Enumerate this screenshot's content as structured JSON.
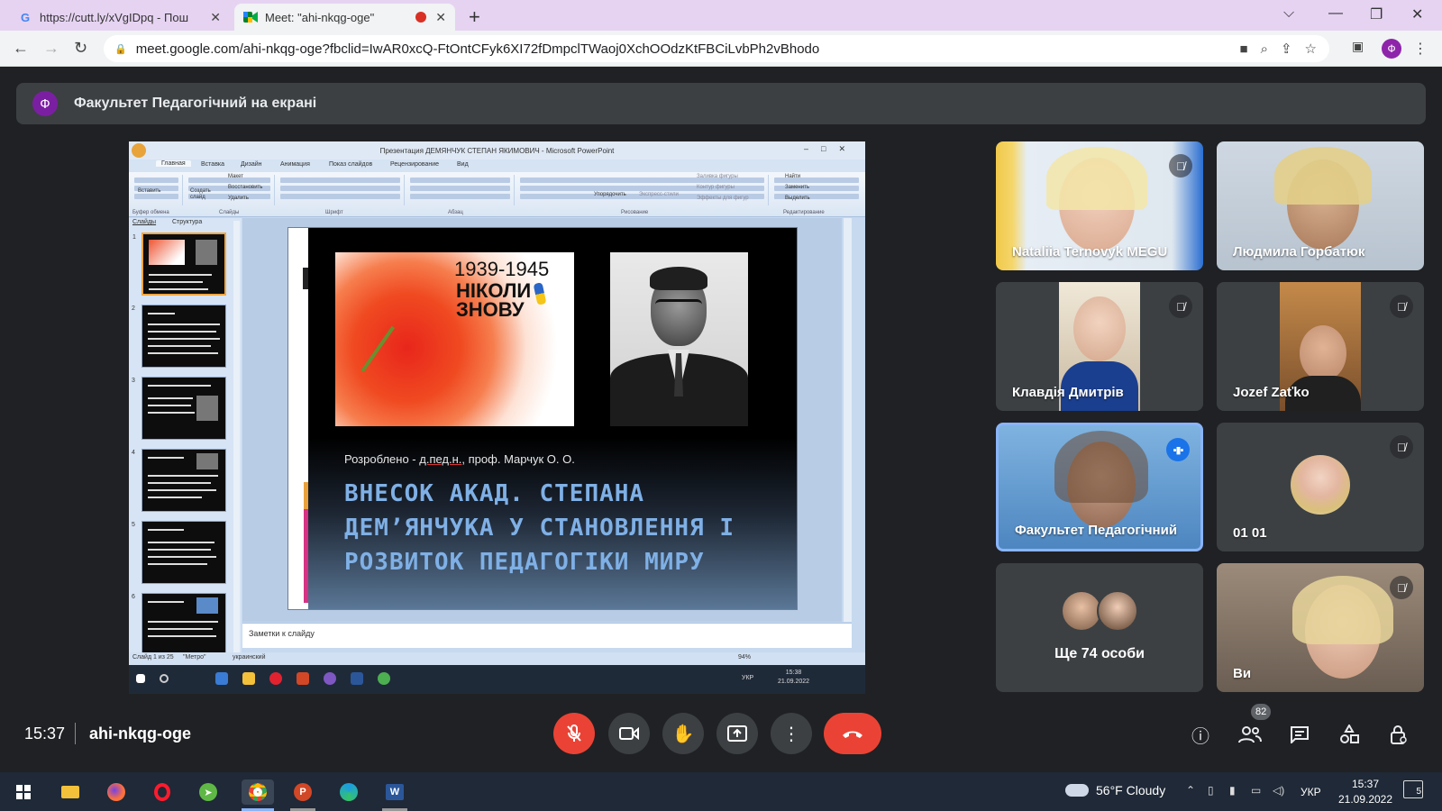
{
  "browser": {
    "tabs": [
      {
        "title": "https://cutt.ly/xVgIDpq - Пош",
        "favicon": "G"
      },
      {
        "title": "Meet: \"ahi-nkqg-oge\"",
        "favicon": "meet-icon"
      }
    ],
    "url": "meet.google.com/ahi-nkqg-oge?fbclid=IwAR0xcQ-FtOntCFyk6XI72fDmpclTWaoj0XchOOdzKtFBCiLvbPh2vBhodo",
    "profile_initial": "Ф"
  },
  "meet": {
    "presenting_banner": "Факультет Педагогічний на екрані",
    "presenter_initial": "Ф",
    "time": "15:37",
    "meeting_code": "ahi-nkqg-oge",
    "participant_count": "82",
    "participants": [
      {
        "name": "Nataliia Ternovyk MEGU",
        "muted": true
      },
      {
        "name": "Людмила Горбатюк",
        "muted": false
      },
      {
        "name": "Клавдія Дмитрів",
        "muted": true
      },
      {
        "name": "Jozef Zaťko",
        "muted": true
      },
      {
        "name": "Факультет Педагогічний",
        "speaking": true
      },
      {
        "name": "01 01",
        "muted": true
      },
      {
        "name": "Ще 74 особи"
      },
      {
        "name": "Ви",
        "muted": true
      }
    ]
  },
  "powerpoint": {
    "window_title": "Презентация ДЕМЯНЧУК СТЕПАН ЯКИМОВИЧ - Microsoft PowerPoint",
    "ribbon_tabs": [
      "Главная",
      "Вставка",
      "Дизайн",
      "Анимация",
      "Показ слайдов",
      "Рецензирование",
      "Вид"
    ],
    "ribbon_groups": [
      "Буфер обмена",
      "Слайды",
      "Шрифт",
      "Абзац",
      "Рисование",
      "Редактирование"
    ],
    "ribbon_buttons": [
      "Вставить",
      "Создать слайд",
      "Макет",
      "Восстановить",
      "Удалить",
      "Упорядочить",
      "Экспресс-стили",
      "Заливка фигуры",
      "Контур фигуры",
      "Эффекты для фигур",
      "Найти",
      "Заменить",
      "Выделить"
    ],
    "panel_tabs": [
      "Слайды",
      "Структура"
    ],
    "slide": {
      "years": "1939-1945",
      "never_again": "НІКОЛИ ЗНОВУ",
      "author_prefix": "Розроблено - ",
      "author_degree": "д.пед.н.",
      "author_rest": ", проф. Марчук О. О.",
      "heading": "ВНЕСОК АКАД. СТЕПАНА ДЕМ’ЯНЧУКА У СТАНОВЛЕННЯ І РОЗВИТОК ПЕДАГОГІКИ МИРУ"
    },
    "notes_placeholder": "Заметки к слайду",
    "status": {
      "slide_of": "Слайд 1 из 25",
      "theme": "\"Метро\"",
      "language": "украинский",
      "zoom": "94%"
    },
    "inner_clock": {
      "time": "15:38",
      "date": "21.09.2022",
      "lang": "УКР"
    }
  },
  "taskbar": {
    "weather": "56°F  Cloudy",
    "language": "УКР",
    "time": "15:37",
    "date": "21.09.2022",
    "notifications": "5"
  }
}
